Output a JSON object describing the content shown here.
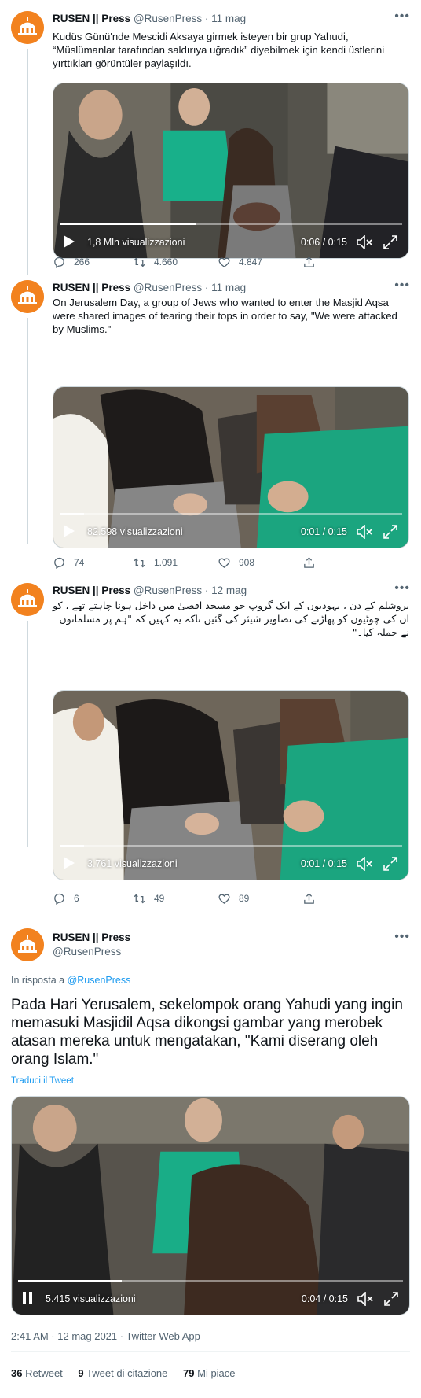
{
  "colors": {
    "accent": "#1d9bf0",
    "avatar_bg": "#f2821f",
    "muted": "#536471"
  },
  "tweets": [
    {
      "name": "RUSEN || Press",
      "handle": "@RusenPress",
      "dot": "·",
      "date": "11 mag",
      "text": "Kudüs Günü'nde Mescidi Aksaya girmek isteyen bir grup Yahudi, “Müslümanlar tarafından saldırıya uğradık” diyebilmek için kendi üstlerini yırttıkları görüntüler paylaşıldı.",
      "video": {
        "views": "1,8 Mln visualizzazioni",
        "time": "0:06 / 0:15",
        "progress": 0.4
      },
      "replies": "266",
      "retweets": "4.660",
      "likes": "4.847"
    },
    {
      "name": "RUSEN || Press",
      "handle": "@RusenPress",
      "dot": "·",
      "date": "11 mag",
      "text": "On Jerusalem Day, a group of Jews who wanted to enter the Masjid Aqsa were shared images of tearing their tops in order to say, \"We were attacked by Muslims.\"",
      "video": {
        "views": "82.598 visualizzazioni",
        "time": "0:01 / 0:15",
        "progress": 0.07
      },
      "replies": "74",
      "retweets": "1.091",
      "likes": "908"
    },
    {
      "name": "RUSEN || Press",
      "handle": "@RusenPress",
      "dot": "·",
      "date": "12 mag",
      "text": "یروشلم کے دن ، یہودیوں کے ایک گروپ جو مسجد اقصیٰ میں داخل ہونا چاہتے تھے ، کو ان کی چوٹیوں کو پھاڑنے کی تصاویر شیئر کی گئیں تاکہ یہ کہیں کہ \"ہم پر مسلمانوں نے حملہ کیا۔\"",
      "video": {
        "views": "3.761 visualizzazioni",
        "time": "0:01 / 0:15",
        "progress": 0.07
      },
      "replies": "6",
      "retweets": "49",
      "likes": "89"
    }
  ],
  "main": {
    "name": "RUSEN || Press",
    "handle": "@RusenPress",
    "reply_prefix": "In risposta a",
    "reply_to": "@RusenPress",
    "text": "Pada Hari Yerusalem, sekelompok orang Yahudi yang ingin memasuki Masjidil Aqsa dikongsi gambar yang merobek atasan mereka untuk mengatakan, \"Kami diserang oleh orang Islam.\"",
    "translate": "Traduci il Tweet",
    "video": {
      "views": "5.415 visualizzazioni",
      "time": "0:04 / 0:15",
      "progress": 0.27
    },
    "timestamp": "2:41 AM · 12 mag 2021 · Twitter Web App",
    "retweets_count": "36",
    "retweets_label": "Retweet",
    "quotes_count": "9",
    "quotes_label": "Tweet di citazione",
    "likes_count": "79",
    "likes_label": "Mi piace"
  }
}
